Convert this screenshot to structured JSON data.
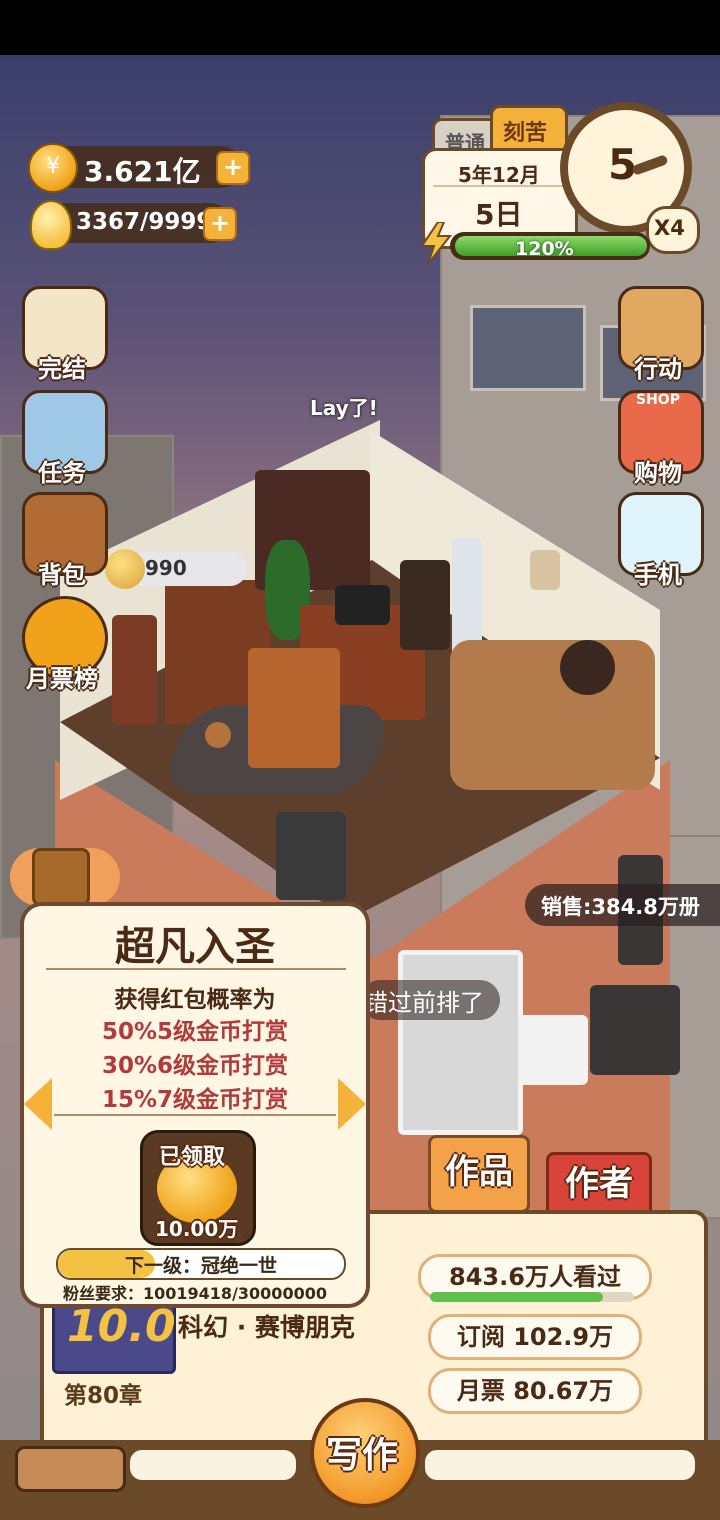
{
  "resources": {
    "coins": "3.621亿",
    "inspiration": "3367/9999",
    "coin_icon": "coin-icon",
    "bulb_icon": "lightbulb-icon"
  },
  "date_widget": {
    "mode_tabs": [
      "普通",
      "刻苦"
    ],
    "month": "5年12月",
    "day": "5日",
    "clock_value": "5",
    "speed": "X4",
    "energy_percent_label": "120%",
    "energy_fill": 1.0
  },
  "left_menu": [
    {
      "label": "完结",
      "icon": "book-icon"
    },
    {
      "label": "任务",
      "icon": "clipboard-icon"
    },
    {
      "label": "背包",
      "icon": "bag-icon"
    },
    {
      "label": "月票榜",
      "icon": "ticket-icon"
    }
  ],
  "right_menu": [
    {
      "label": "行动",
      "icon": "door-icon"
    },
    {
      "label": "购物",
      "icon": "shop-icon",
      "sign": "SHOP"
    },
    {
      "label": "手机",
      "icon": "phone-icon"
    }
  ],
  "scene": {
    "speech_bubble": "Lay了!",
    "coin_bubble": "990",
    "sales": "销售:384.8万册",
    "comment_fragment": "错过前排了"
  },
  "popup": {
    "title": "超凡入圣",
    "desc": "获得红包概率为",
    "odds": [
      "50%5级金币打赏",
      "30%6级金币打赏",
      "15%7级金币打赏"
    ],
    "claimed_label": "已领取",
    "reward": "10.00万",
    "next_level": "下一级：冠绝一世",
    "fans_req": "粉丝要求：10019418/30000000"
  },
  "book": {
    "rating": "10.0",
    "chapter": "第80章",
    "genre": "科幻 · 赛博朋克",
    "views": "843.6万人看过",
    "views_fill": 0.85,
    "subscriptions": "订阅 102.9万",
    "monthly_tickets": "月票 80.67万",
    "tab_works": "作品",
    "tab_author": "作者",
    "write_button": "写作"
  }
}
